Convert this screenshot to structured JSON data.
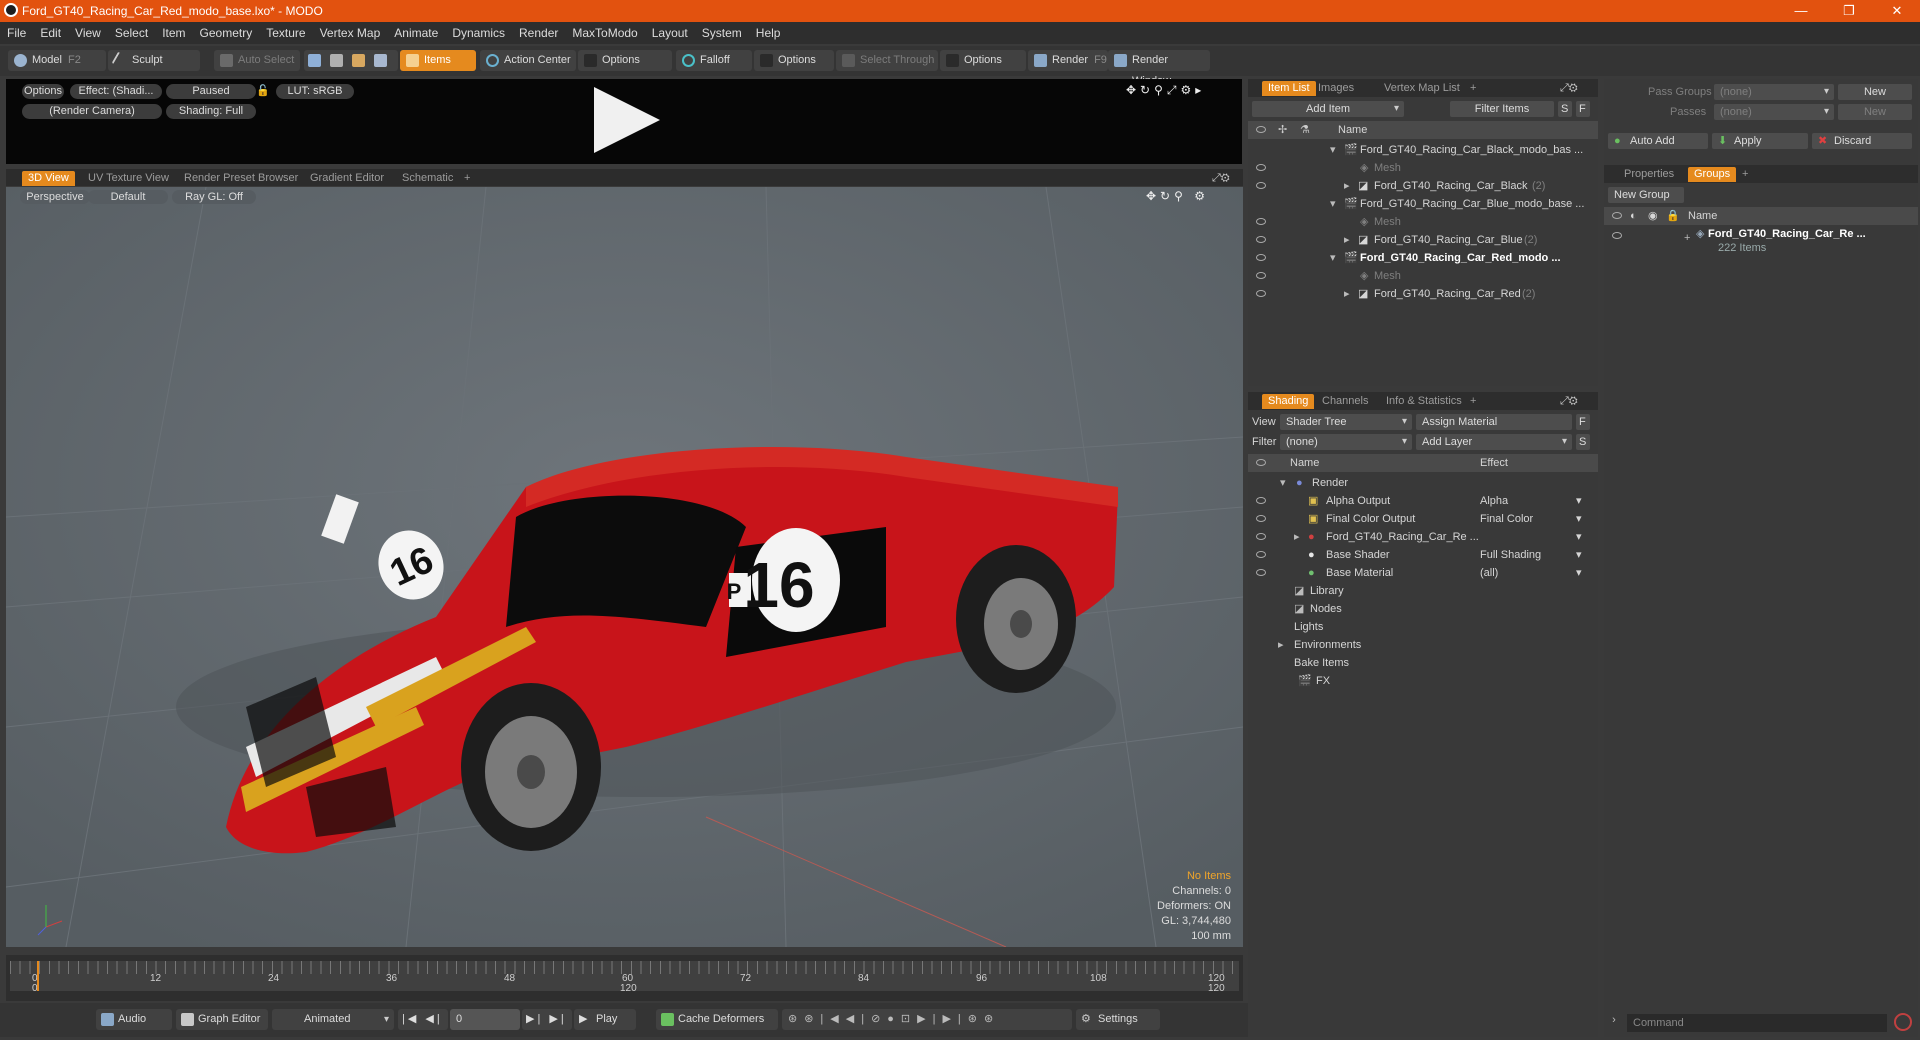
{
  "window": {
    "title": "Ford_GT40_Racing_Car_Red_modo_base.lxo* - MODO",
    "minimize": "—",
    "restore": "❐",
    "close": "✕"
  },
  "menu": [
    "File",
    "Edit",
    "View",
    "Select",
    "Item",
    "Geometry",
    "Texture",
    "Vertex Map",
    "Animate",
    "Dynamics",
    "Render",
    "MaxToModo",
    "Layout",
    "System",
    "Help"
  ],
  "toolbar": {
    "model": "Model",
    "model_key": "F2",
    "sculpt": "Sculpt",
    "auto_select": "Auto Select",
    "items": "Items",
    "action_center": "Action Center",
    "options1": "Options",
    "falloff": "Falloff",
    "options2": "Options",
    "select_through": "Select Through",
    "options3": "Options",
    "render": "Render",
    "render_key": "F9",
    "render_window": "Render Window"
  },
  "preview": {
    "options": "Options",
    "effect": "Effect: (Shadi...",
    "paused": "Paused",
    "lut": "LUT: sRGB",
    "camera": "(Render Camera)",
    "shading": "Shading: Full"
  },
  "viewport_tabs": [
    "3D View",
    "UV Texture View",
    "Render Preset Browser",
    "Gradient Editor",
    "Schematic",
    "+"
  ],
  "viewport": {
    "perspective": "Perspective",
    "default": "Default",
    "raygl": "Ray GL: Off"
  },
  "stats": {
    "items": "No Items",
    "channels": "Channels: 0",
    "deformers": "Deformers: ON",
    "gl": "GL: 3,744,480",
    "scale": "100 mm"
  },
  "timeline": {
    "ticks": [
      "0",
      "12",
      "24",
      "36",
      "48",
      "60",
      "72",
      "84",
      "96",
      "108",
      "120"
    ],
    "start": "0",
    "mid": "120",
    "end": "120"
  },
  "bottom": {
    "audio": "Audio",
    "graph_editor": "Graph Editor",
    "animated": "Animated",
    "frame": "0",
    "play": "Play",
    "cache": "Cache Deformers",
    "settings": "Settings"
  },
  "item_list": {
    "tabs": [
      "Item List",
      "Images",
      "Vertex Map List",
      "+"
    ],
    "add_item": "Add Item",
    "filter_items": "Filter Items",
    "s": "S",
    "f": "F",
    "name_col": "Name",
    "rows": [
      {
        "label": "Ford_GT40_Racing_Car_Black_modo_bas ...",
        "count": "",
        "bold": false
      },
      {
        "label": "Mesh",
        "count": "",
        "bold": false
      },
      {
        "label": "Ford_GT40_Racing_Car_Black",
        "count": "(2)",
        "bold": false
      },
      {
        "label": "Ford_GT40_Racing_Car_Blue_modo_base ...",
        "count": "",
        "bold": false
      },
      {
        "label": "Mesh",
        "count": "",
        "bold": false
      },
      {
        "label": "Ford_GT40_Racing_Car_Blue",
        "count": "(2)",
        "bold": false
      },
      {
        "label": "Ford_GT40_Racing_Car_Red_modo ...",
        "count": "",
        "bold": true
      },
      {
        "label": "Mesh",
        "count": "",
        "bold": false
      },
      {
        "label": "Ford_GT40_Racing_Car_Red",
        "count": "(2)",
        "bold": false
      }
    ]
  },
  "shading": {
    "tabs": [
      "Shading",
      "Channels",
      "Info & Statistics",
      "+"
    ],
    "view_label": "View",
    "view_value": "Shader Tree",
    "assign": "Assign Material",
    "f": "F",
    "filter_label": "Filter",
    "filter_value": "(none)",
    "add_layer": "Add Layer",
    "s": "S",
    "name_col": "Name",
    "effect_col": "Effect",
    "rows": [
      {
        "label": "Render",
        "effect": ""
      },
      {
        "label": "Alpha Output",
        "effect": "Alpha"
      },
      {
        "label": "Final Color Output",
        "effect": "Final Color"
      },
      {
        "label": "Ford_GT40_Racing_Car_Re ...",
        "effect": ""
      },
      {
        "label": "Base Shader",
        "effect": "Full Shading"
      },
      {
        "label": "Base Material",
        "effect": "(all)"
      },
      {
        "label": "Library",
        "effect": ""
      },
      {
        "label": "Nodes",
        "effect": ""
      },
      {
        "label": "Lights",
        "effect": ""
      },
      {
        "label": "Environments",
        "effect": ""
      },
      {
        "label": "Bake Items",
        "effect": ""
      },
      {
        "label": "FX",
        "effect": ""
      }
    ]
  },
  "groups": {
    "pass_groups_label": "Pass Groups",
    "pass_groups_value": "(none)",
    "new1": "New",
    "passes_label": "Passes",
    "passes_value": "(none)",
    "new2": "New",
    "auto_add": "Auto Add",
    "apply": "Apply",
    "discard": "Discard",
    "tabs": [
      "Properties",
      "Groups",
      "+"
    ],
    "new_group": "New Group",
    "name_col": "Name",
    "group_name": "Ford_GT40_Racing_Car_Re ...",
    "group_count": "222 Items"
  },
  "command": {
    "placeholder": "Command"
  },
  "car": {
    "number": "16",
    "class": "P"
  },
  "colors": {
    "accent": "#e58a1e",
    "title": "#e2520f",
    "car_red": "#c8141a",
    "stripe": "#d9a21e"
  }
}
